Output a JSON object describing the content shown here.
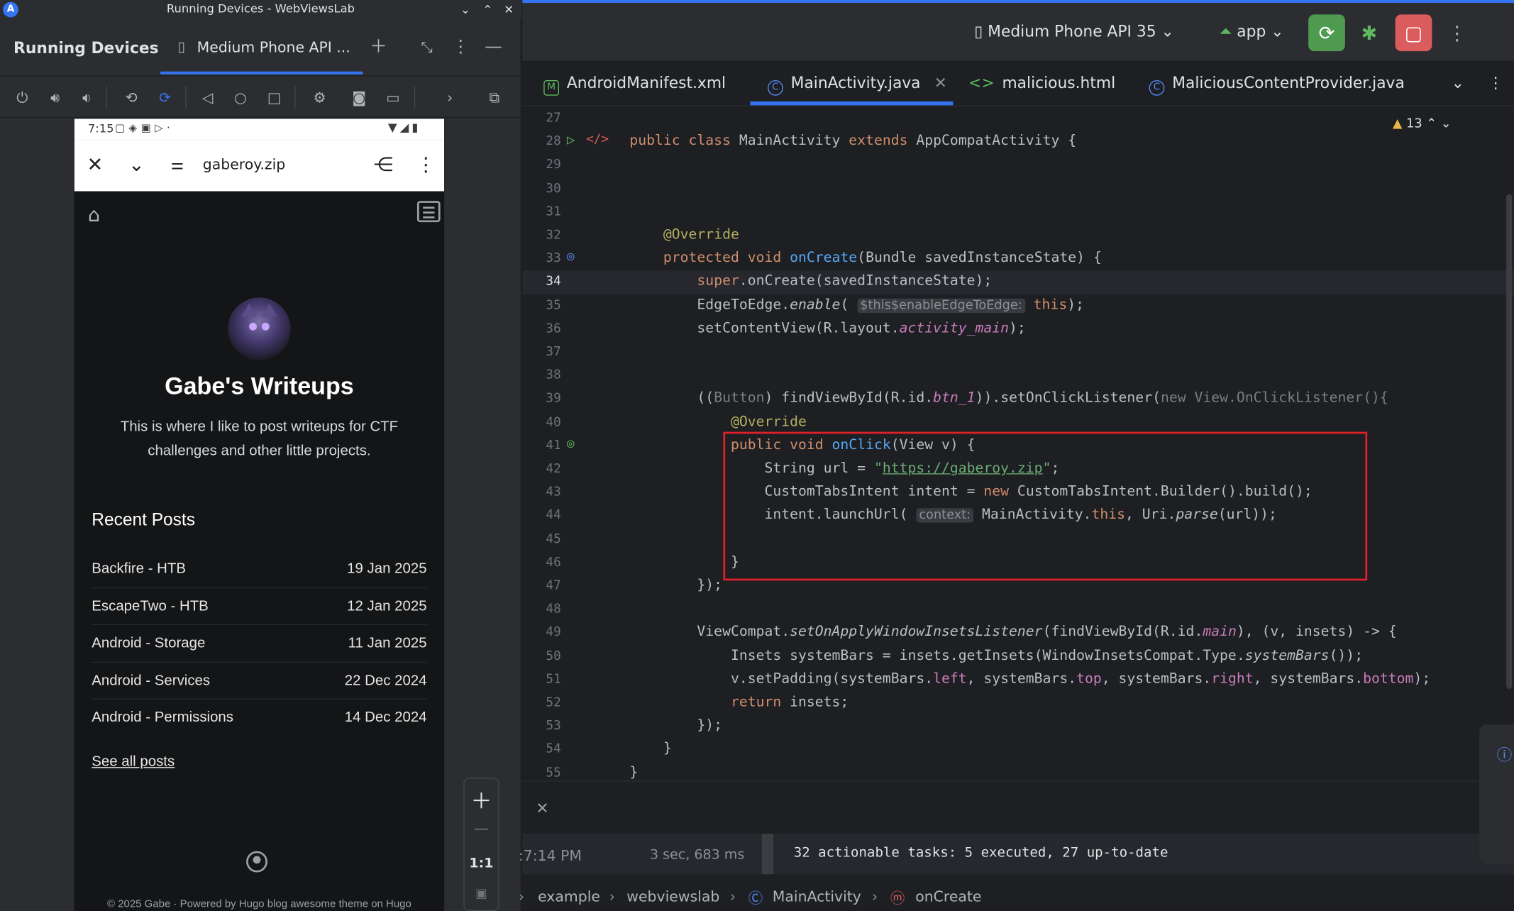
{
  "window": {
    "title": "Running Devices - WebViewsLab"
  },
  "left_panel": {
    "title": "Running Devices",
    "tab_label": "Medium Phone API ..."
  },
  "phone": {
    "status_time": "7:15",
    "url": "gaberoy.zip",
    "site_title": "Gabe's Writeups",
    "site_description": "This is where I like to post writeups for CTF challenges and other little projects.",
    "recent_heading": "Recent Posts",
    "posts": [
      {
        "title": "Backfire - HTB",
        "date": "19 Jan 2025"
      },
      {
        "title": "EscapeTwo - HTB",
        "date": "12 Jan 2025"
      },
      {
        "title": "Android - Storage",
        "date": "11 Jan 2025"
      },
      {
        "title": "Android - Services",
        "date": "22 Dec 2024"
      },
      {
        "title": "Android - Permissions",
        "date": "14 Dec 2024"
      }
    ],
    "see_all": "See all posts",
    "footer": "© 2025 Gabe · Powered by Hugo blog awesome theme on Hugo"
  },
  "zoom": {
    "ratio": "1:1"
  },
  "ide": {
    "device_selector": "Medium Phone API 35",
    "run_config": "app",
    "tabs": [
      "AndroidManifest.xml",
      "MainActivity.java",
      "malicious.html",
      "MaliciousContentProvider.java"
    ],
    "warnings_count": "13",
    "code_lines": [
      {
        "n": "27",
        "html": ""
      },
      {
        "n": "28",
        "html": "<span class=\"kw\">public class</span> MainActivity <span class=\"kw\">extends</span> AppCompatActivity {"
      },
      {
        "n": "29",
        "html": ""
      },
      {
        "n": "30",
        "html": ""
      },
      {
        "n": "31",
        "html": ""
      },
      {
        "n": "32",
        "html": "    <span class=\"an\">@Override</span>"
      },
      {
        "n": "33",
        "html": "    <span class=\"kw\">protected void</span> <span class=\"fn\">onCreate</span>(Bundle savedInstanceState) {"
      },
      {
        "n": "34",
        "html": "        <span class=\"kw\">super</span>.onCreate(savedInstanceState);"
      },
      {
        "n": "35",
        "html": "        EdgeToEdge.<span class=\"it\">enable</span>( <span class=\"hint\">$this$enableEdgeToEdge:</span> <span class=\"kw\">this</span>);"
      },
      {
        "n": "36",
        "html": "        setContentView(R.layout.<span class=\"pu it\">activity_main</span>);"
      },
      {
        "n": "37",
        "html": ""
      },
      {
        "n": "38",
        "html": ""
      },
      {
        "n": "39",
        "html": "        ((<span class=\"gray\">Button</span>) findViewById(R.id.<span class=\"pu it\">btn_1</span>)).setOnClickListener(<span class=\"gray\">new View.OnClickListener(){</span>"
      },
      {
        "n": "40",
        "html": "            <span class=\"an\">@Override</span>"
      },
      {
        "n": "41",
        "html": "            <span class=\"kw\">public void</span> <span class=\"fn\">onClick</span>(View v) {"
      },
      {
        "n": "42",
        "html": "                String url = <span class=\"st\">\"<span class=\"ul\">https://gaberoy.zip</span>\"</span>;"
      },
      {
        "n": "43",
        "html": "                CustomTabsIntent intent = <span class=\"kw\">new</span> CustomTabsIntent.Builder().build();"
      },
      {
        "n": "44",
        "html": "                intent.launchUrl( <span class=\"hint\">context:</span> MainActivity.<span class=\"kw\">this</span>, Uri.<span class=\"it\">parse</span>(url));"
      },
      {
        "n": "45",
        "html": ""
      },
      {
        "n": "46",
        "html": "            }"
      },
      {
        "n": "47",
        "html": "        });"
      },
      {
        "n": "48",
        "html": ""
      },
      {
        "n": "49",
        "html": "        ViewCompat.<span class=\"it\">setOnApplyWindowInsetsListener</span>(findViewById(R.id.<span class=\"pu it\">main</span>), (v, insets) -> {"
      },
      {
        "n": "50",
        "html": "            Insets systemBars = insets.getInsets(WindowInsetsCompat.Type.<span class=\"it\">systemBars</span>());"
      },
      {
        "n": "51",
        "html": "            v.setPadding(systemBars.<span class=\"pu\">left</span>, systemBars.<span class=\"pu\">top</span>, systemBars.<span class=\"pu\">right</span>, systemBars.<span class=\"pu\">bottom</span>);"
      },
      {
        "n": "52",
        "html": "            <span class=\"kw\">return</span> insets;"
      },
      {
        "n": "53",
        "html": "        });"
      },
      {
        "n": "54",
        "html": "    }"
      },
      {
        "n": "55",
        "html": "}"
      }
    ],
    "build": {
      "time": ":7:14 PM",
      "duration": "3 sec, 683 ms",
      "message": "32 actionable tasks: 5 executed, 27 up-to-date"
    },
    "breadcrumbs": [
      "example",
      "webviewslab",
      "MainActivity",
      "onCreate"
    ]
  },
  "colors": {
    "accent": "#3574f0",
    "highlight": "#e0202a",
    "run": "#4e9a4f",
    "stop": "#db5c5c"
  }
}
